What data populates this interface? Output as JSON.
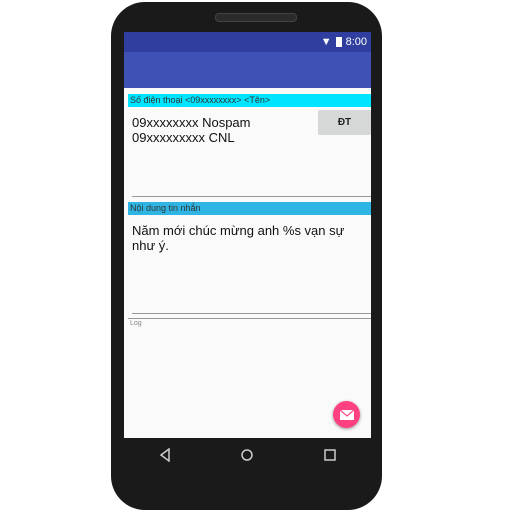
{
  "status": {
    "time": "8:00"
  },
  "phone_section": {
    "label": "Số điện thoại <09xxxxxxxx> <Tên>",
    "lines": [
      "09xxxxxxxx Nospam",
      "09xxxxxxxxx CNL"
    ],
    "button": "ĐT"
  },
  "message_section": {
    "label": "Nội dung tin nhắn",
    "text": "Năm mới chúc mừng anh %s vạn sự như ý."
  },
  "log_label": "Log",
  "colors": {
    "primary": "#3f51b5",
    "primary_dark": "#303f9f",
    "accent": "#ff4081"
  }
}
